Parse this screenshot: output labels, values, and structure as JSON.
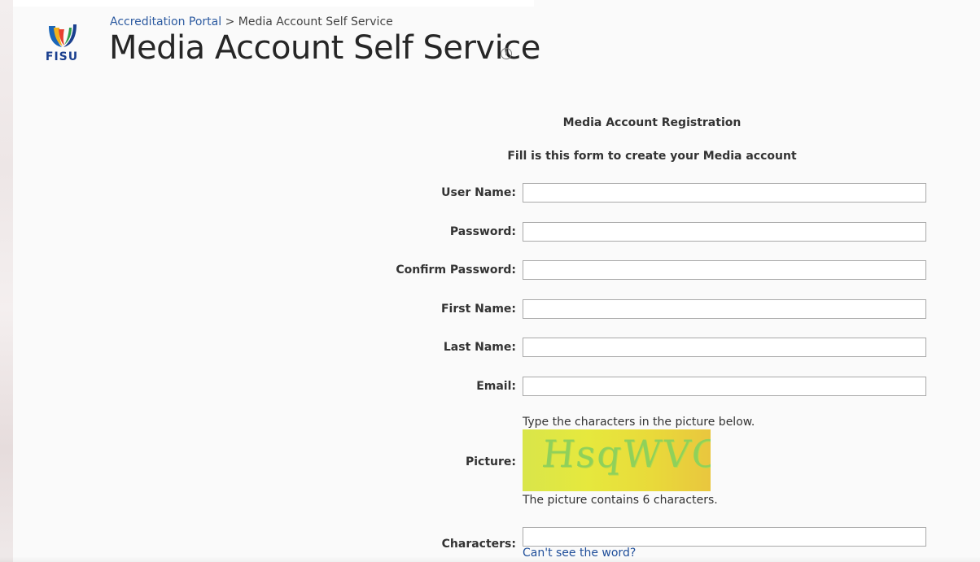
{
  "brand": {
    "logo_text": "FISU"
  },
  "breadcrumb": {
    "root_link": "Accreditation Portal",
    "separator": ">",
    "current": "Media Account Self Service"
  },
  "header": {
    "title": "Media Account Self Service",
    "info_icon": "info-icon"
  },
  "form": {
    "title": "Media Account Registration",
    "subtitle": "Fill is this form to create your Media account",
    "fields": [
      {
        "label": "User Name:",
        "value": "",
        "type": "text"
      },
      {
        "label": "Password:",
        "value": "",
        "type": "password"
      },
      {
        "label": "Confirm Password:",
        "value": "",
        "type": "password"
      },
      {
        "label": "First Name:",
        "value": "",
        "type": "text"
      },
      {
        "label": "Last Name:",
        "value": "",
        "type": "text"
      },
      {
        "label": "Email:",
        "value": "",
        "type": "text"
      }
    ],
    "captcha": {
      "label": "Picture:",
      "instruction": "Type the characters in the picture below.",
      "image_text": "HsqWVC",
      "note": "The picture contains 6 characters.",
      "characters_label": "Characters:",
      "characters_value": "",
      "help_link": "Can't see the word?"
    }
  },
  "colors": {
    "link": "#2c5aa0",
    "title": "#262626",
    "logo_blue": "#1a3f8f",
    "captcha_bg": "#e6e83d"
  }
}
